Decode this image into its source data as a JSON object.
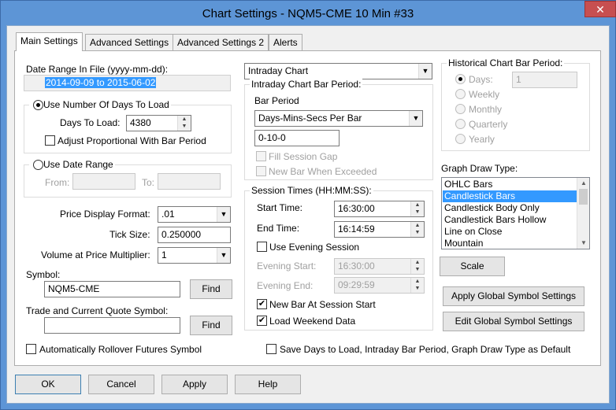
{
  "window": {
    "title": "Chart Settings - NQM5-CME  10 Min   #33",
    "close_icon": "close-icon"
  },
  "tabs": [
    "Main Settings",
    "Advanced Settings",
    "Advanced Settings 2",
    "Alerts"
  ],
  "left": {
    "date_range_label": "Date Range In File (yyyy-mm-dd):",
    "date_range_value": "2014-09-09 to 2015-06-02",
    "use_days_label": "Use Number Of Days To Load",
    "days_to_load_label": "Days To Load:",
    "days_to_load_value": "4380",
    "adjust_label": "Adjust Proportional With Bar Period",
    "use_date_range_label": "Use Date Range",
    "from_label": "From:",
    "to_label": "To:",
    "price_format_label": "Price Display Format:",
    "price_format_value": ".01",
    "tick_size_label": "Tick Size:",
    "tick_size_value": "0.250000",
    "vap_label": "Volume at Price Multiplier:",
    "vap_value": "1",
    "symbol_label": "Symbol:",
    "symbol_value": "NQM5-CME",
    "find_label": "Find",
    "trade_symbol_label": "Trade and Current Quote Symbol:",
    "trade_symbol_value": "",
    "rollover_label": "Automatically Rollover Futures Symbol"
  },
  "middle": {
    "chart_type_value": "Intraday Chart",
    "intraday_group_label": "Intraday Chart Bar Period:",
    "bar_period_label": "Bar Period",
    "bar_period_value": "Days-Mins-Secs Per Bar",
    "bar_period_text": "0-10-0",
    "fill_gap_label": "Fill Session Gap",
    "new_bar_exceeded_label": "New Bar When Exceeded",
    "session_group_label": "Session Times (HH:MM:SS):",
    "start_time_label": "Start Time:",
    "start_time_value": "16:30:00",
    "end_time_label": "End Time:",
    "end_time_value": "16:14:59",
    "use_evening_label": "Use Evening Session",
    "evening_start_label": "Evening Start:",
    "evening_start_value": "16:30:00",
    "evening_end_label": "Evening End:",
    "evening_end_value": "09:29:59",
    "new_bar_session_label": "New Bar At Session Start",
    "load_weekend_label": "Load Weekend Data",
    "save_default_label": "Save Days to Load, Intraday Bar Period, Graph Draw Type as Default"
  },
  "right": {
    "hist_group_label": "Historical Chart Bar Period:",
    "days_label": "Days:",
    "days_value": "1",
    "weekly_label": "Weekly",
    "monthly_label": "Monthly",
    "quarterly_label": "Quarterly",
    "yearly_label": "Yearly",
    "graph_draw_label": "Graph Draw Type:",
    "graph_types": [
      "OHLC Bars",
      "Candlestick Bars",
      "Candlestick Body Only",
      "Candlestick Bars Hollow",
      "Line on Close",
      "Mountain"
    ],
    "selected_graph_type": "Candlestick Bars",
    "scale_label": "Scale",
    "apply_global_label": "Apply Global Symbol Settings",
    "edit_global_label": "Edit Global Symbol Settings"
  },
  "footer": {
    "ok": "OK",
    "cancel": "Cancel",
    "apply": "Apply",
    "help": "Help"
  },
  "colors": {
    "selection": "#3399ff",
    "title_bar": "#5d95d6",
    "close_button": "#c74f50"
  }
}
